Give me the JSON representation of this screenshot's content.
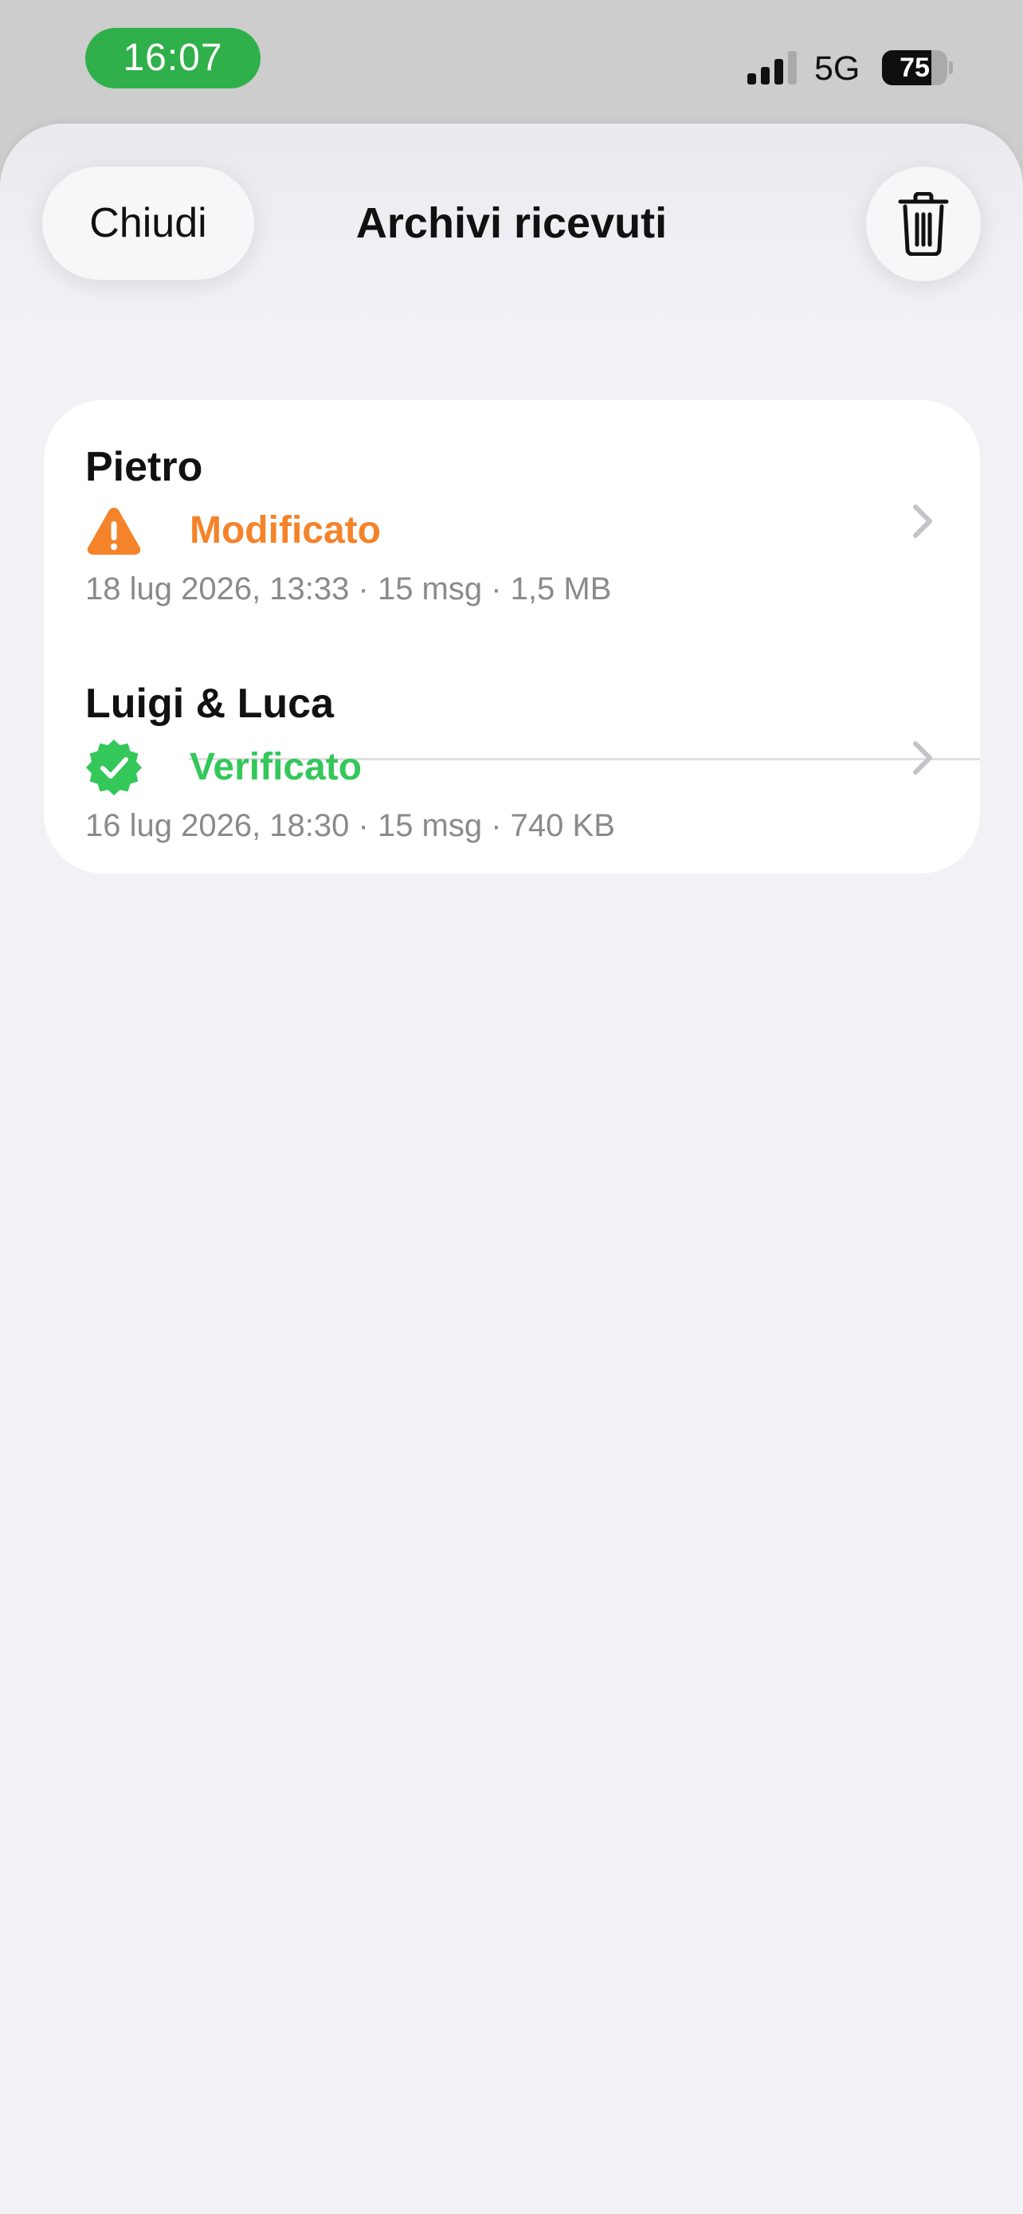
{
  "status_bar": {
    "time": "16:07",
    "network": "5G",
    "battery_percent": 75,
    "battery_label": "75",
    "signal_bars_active": 3,
    "signal_bars_total": 4,
    "time_pill_color": "#2fb04a"
  },
  "header": {
    "close_label": "Chiudi",
    "title": "Archivi ricevuti",
    "trash_icon": "trash-icon"
  },
  "archives": [
    {
      "name": "Pietro",
      "status": "Modificato",
      "status_icon": "warning-triangle-icon",
      "status_color": "#f5832a",
      "meta": "18 lug 2026, 13:33 · 15 msg · 1,5 MB"
    },
    {
      "name": "Luigi & Luca",
      "status": "Verificato",
      "status_icon": "verified-badge-icon",
      "status_color": "#34c759",
      "meta": "16 lug 2026, 18:30 · 15 msg · 740 KB"
    }
  ]
}
